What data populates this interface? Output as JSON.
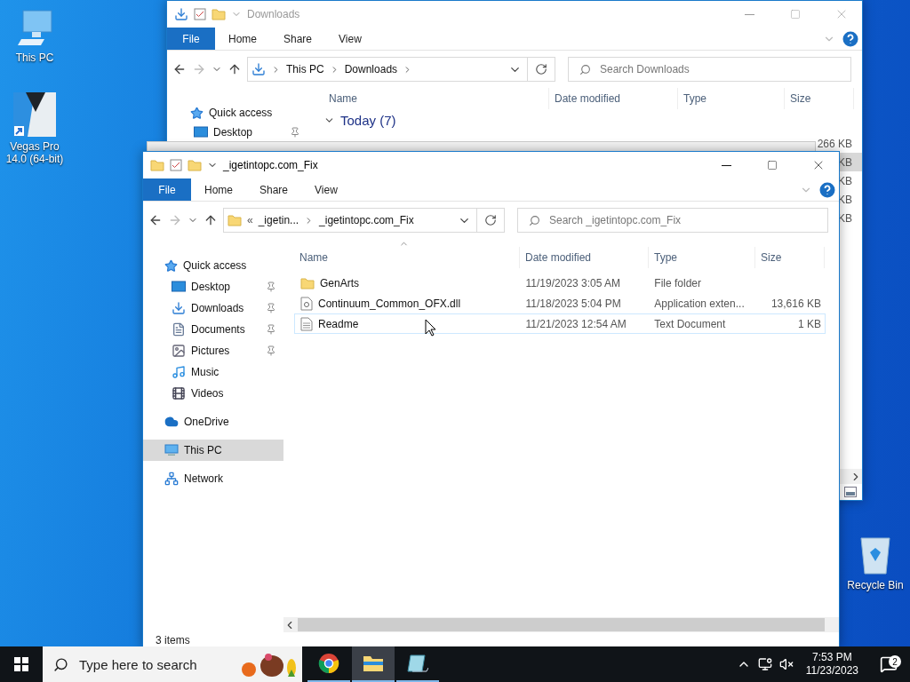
{
  "desktop_icons": [
    {
      "label": "This PC",
      "kind": "computer"
    },
    {
      "label": "Vegas Pro 14.0 (64-bit)",
      "kind": "vegas"
    }
  ],
  "recycle_bin": {
    "label": "Recycle Bin"
  },
  "back_window": {
    "title": "Downloads",
    "file_tab": "File",
    "ribbon_tabs": [
      "Home",
      "Share",
      "View"
    ],
    "address": [
      "This PC",
      "Downloads"
    ],
    "search_placeholder": "Search Downloads",
    "columns": [
      "Name",
      "Date modified",
      "Type",
      "Size"
    ],
    "nav_items": [
      {
        "label": "Quick access",
        "kind": "star"
      },
      {
        "label": "Desktop",
        "kind": "desktop",
        "pinned": true
      }
    ],
    "group": "Today (7)",
    "size_cells": [
      {
        "text": "266 KB",
        "selected": false
      },
      {
        "text": "KB",
        "selected": true
      },
      {
        "text": "KB",
        "selected": false
      },
      {
        "text": "KB",
        "selected": false
      },
      {
        "text": "KB",
        "selected": false
      }
    ]
  },
  "front_window": {
    "title": "_igetintopc.com_Fix",
    "file_tab": "File",
    "ribbon_tabs": [
      "Home",
      "Share",
      "View"
    ],
    "address_prefix": "«",
    "address": [
      "_igetin...",
      "_igetintopc.com_Fix"
    ],
    "search_placeholder": "Search _igetintopc.com_Fix",
    "columns": [
      "Name",
      "Date modified",
      "Type",
      "Size"
    ],
    "nav_items": [
      {
        "label": "Quick access",
        "kind": "star",
        "selected": false,
        "children": [
          {
            "label": "Desktop",
            "kind": "desktop",
            "pinned": true,
            "selected": false
          },
          {
            "label": "Downloads",
            "kind": "download",
            "pinned": true,
            "selected": false
          },
          {
            "label": "Documents",
            "kind": "document",
            "pinned": true,
            "selected": false
          },
          {
            "label": "Pictures",
            "kind": "pictures",
            "pinned": true,
            "selected": false
          },
          {
            "label": "Music",
            "kind": "music",
            "pinned": false,
            "selected": false
          },
          {
            "label": "Videos",
            "kind": "videos",
            "pinned": false,
            "selected": false
          }
        ]
      },
      {
        "label": "OneDrive",
        "kind": "cloud",
        "selected": false
      },
      {
        "label": "This PC",
        "kind": "computer",
        "selected": true
      },
      {
        "label": "Network",
        "kind": "network",
        "selected": false
      }
    ],
    "files": [
      {
        "name": "GenArts",
        "date": "11/19/2023 3:05 AM",
        "type": "File folder",
        "kind": "folder",
        "selected": false
      },
      {
        "name": "Continuum_Common_OFX.dll",
        "date": "11/18/2023 5:04 PM",
        "type": "Application exten...",
        "size": "13,616 KB",
        "kind": "dll",
        "selected": false
      },
      {
        "name": "Readme",
        "date": "11/21/2023 12:54 AM",
        "type": "Text Document",
        "size": "1 KB",
        "kind": "text",
        "selected": true
      }
    ],
    "status": "3 items"
  },
  "taskbar": {
    "search_placeholder": "Type here to search",
    "apps": [
      {
        "kind": "chrome",
        "active": false
      },
      {
        "kind": "explorer",
        "active": true
      },
      {
        "kind": "notepad",
        "active": false
      }
    ],
    "time": "7:53 PM",
    "date": "11/23/2023",
    "notifications": "2"
  }
}
